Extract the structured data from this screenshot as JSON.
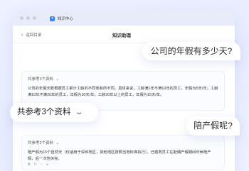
{
  "window": {
    "app_name": "知识中心",
    "app_logo_glyph": "✦"
  },
  "nav": {
    "back_label": "返回目录",
    "back_icon": "chevron-left-icon",
    "page_title": "知识助理"
  },
  "bubbles": {
    "question_1": "公司的年假有多少天?",
    "references": "共参考3个资料",
    "question_2": "陪产假呢?"
  },
  "cards": [
    {
      "ref_label": "共参考3个资料",
      "answer": "公司的年假天数根据员工累计工龄的不同而有所不同。具体来说，工龄满1年不满10年的员工，年假为5天/年；工龄满10年不满20年的员工，年假为10天/年；工龄20年以上的员工，年假为15天/年。"
    },
    {
      "ref_label": "共参考2个资料",
      "answer": "陪产假为15个自然天（仅适用于深圳地区，其他地区按照当地标准执行）。已婚男员工在配偶产假期间可休陪产假，后一次性休完。"
    }
  ],
  "colors": {
    "accent": "#3b82f6",
    "background": "#e9eeff"
  }
}
